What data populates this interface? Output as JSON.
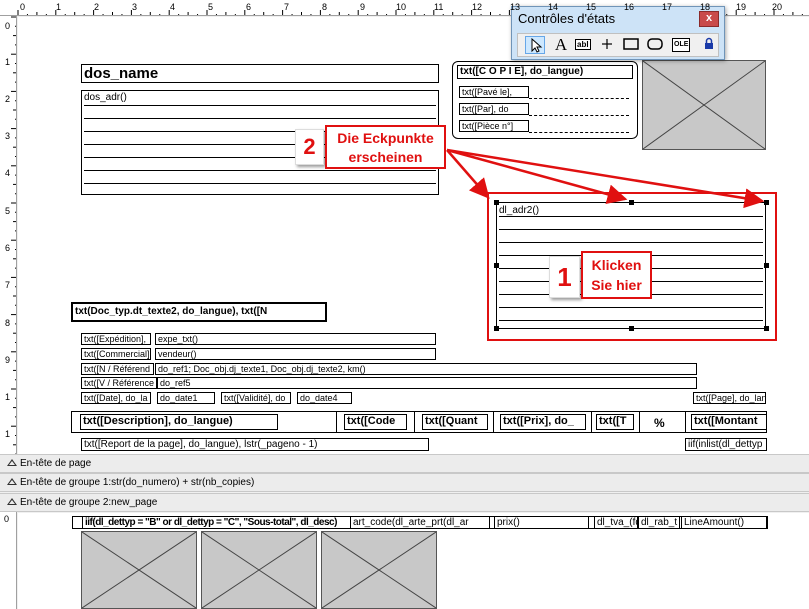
{
  "ruler": {
    "top_numbers": [
      "0",
      "1",
      "2",
      "3",
      "4",
      "5",
      "6",
      "7",
      "8",
      "9",
      "10",
      "11",
      "12",
      "13",
      "14",
      "15",
      "16",
      "17",
      "18",
      "19",
      "20"
    ],
    "left_numbers": [
      "0",
      "1",
      "2",
      "3",
      "4",
      "5",
      "6",
      "7",
      "8",
      "9",
      "1",
      "1"
    ],
    "left_numbers_bottom": [
      "0"
    ]
  },
  "controls_window": {
    "title": "Contrôles d'états",
    "close_label": "x",
    "tools": [
      "pointer-icon",
      "text-icon",
      "field-icon",
      "line-icon",
      "rectangle-icon",
      "rounded-rectangle-icon",
      "ole-object-icon",
      "lock-icon"
    ],
    "text_tool_label": "A",
    "field_tool_label": "abl",
    "ole_tool_label": "OLE"
  },
  "report": {
    "dos_name": "dos_name",
    "dos_adr": "dos_adr()",
    "copie": "txt([C O P I E], do_langue)",
    "pave_le": "txt([Pavé le],",
    "par": "txt([Par], do",
    "piece": "txt([Pièce n°]",
    "dl_adr": "dl_adr2()",
    "doc_typ": "txt(Doc_typ.dt_texte2, do_langue), txt([N",
    "expedition": "txt([Expédition],",
    "expe_txt": "expe_txt()",
    "commercial": "txt([Commercial]",
    "vendeur": "vendeur()",
    "n_reference": "txt([N / Référend",
    "do_ref1": "do_ref1; Doc_obj.dj_texte1, Doc_obj.dj_texte2, km()",
    "v_reference": "txt([V / Référence",
    "do_ref5": "do_ref5",
    "date": "txt([Date], do_la",
    "do_date1": "do_date1",
    "validite": "txt([Validité], do",
    "do_date4": "do_date4",
    "page": "txt([Page], do_lan",
    "description": "txt([Description], do_langue)",
    "code": "txt([Code",
    "quant": "txt([Quant",
    "prix": "txt([Prix], do_",
    "t": "txt([T",
    "percent": "%",
    "montant": "txt([Montant",
    "report_page": "txt([Report de la page], do_langue), lstr(_pageno - 1)",
    "iif": "iif(inlist(dl_dettyp"
  },
  "bands": {
    "page_header": "En-tête de page",
    "group1": "En-tête de groupe 1:str(do_numero) + str(nb_copies)",
    "group2": "En-tête de groupe 2:new_page"
  },
  "detail": {
    "overlap": "iif(dl_dettyp = \"B\" or dl_dettyp = \"C\", \"Sous-total\", dl_desc)",
    "art_code": "art_code(dl_arte_prt(dl_ar",
    "prix": "prix()",
    "dl_tva": "dl_tva_(fd",
    "dl_rab": "dl_rab_t",
    "line_amount": "LineAmount()"
  },
  "annotations": {
    "step1_number": "1",
    "step1_text": "Klicken Sie hier",
    "step2_number": "2",
    "step2_text": "Die Eckpunkte erscheinen",
    "color": "#e01010"
  }
}
